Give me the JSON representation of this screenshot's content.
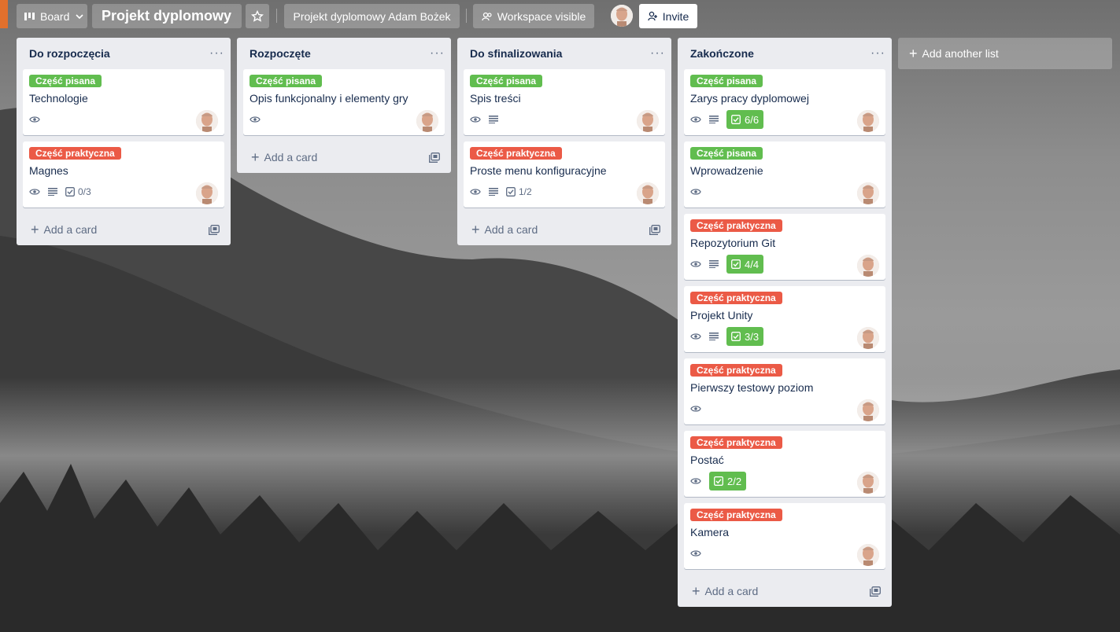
{
  "header": {
    "board_switch_label": "Board",
    "board_title": "Projekt dyplomowy",
    "workspace_name": "Projekt dyplomowy Adam Bożek",
    "visibility_label": "Workspace visible",
    "invite_label": "Invite"
  },
  "colors": {
    "label_green": "#61bd4f",
    "label_red": "#eb5a46",
    "list_bg": "#ebecf0"
  },
  "lists": [
    {
      "title": "Do rozpoczęcia",
      "add_card": "Add a card",
      "cards": [
        {
          "label": "Część pisana",
          "title": "Technologie",
          "checklist": ""
        },
        {
          "label": "Część praktyczna",
          "title": "Magnes",
          "checklist": "0/3"
        }
      ]
    },
    {
      "title": "Rozpoczęte",
      "add_card": "Add a card",
      "cards": [
        {
          "label": "Część pisana",
          "title": "Opis funkcjonalny i elementy gry",
          "checklist": ""
        }
      ]
    },
    {
      "title": "Do sfinalizowania",
      "add_card": "Add a card",
      "cards": [
        {
          "label": "Część pisana",
          "title": "Spis treści",
          "checklist": ""
        },
        {
          "label": "Część praktyczna",
          "title": "Proste menu konfiguracyjne",
          "checklist": "1/2"
        }
      ]
    },
    {
      "title": "Zakończone",
      "add_card": "Add a card",
      "cards": [
        {
          "label": "Część pisana",
          "title": "Zarys pracy dyplomowej",
          "checklist": "6/6"
        },
        {
          "label": "Część pisana",
          "title": "Wprowadzenie",
          "checklist": ""
        },
        {
          "label": "Część praktyczna",
          "title": "Repozytorium Git",
          "checklist": "4/4"
        },
        {
          "label": "Część praktyczna",
          "title": "Projekt Unity",
          "checklist": "3/3"
        },
        {
          "label": "Część praktyczna",
          "title": "Pierwszy testowy poziom",
          "checklist": ""
        },
        {
          "label": "Część praktyczna",
          "title": "Postać",
          "checklist": "2/2"
        },
        {
          "label": "Część praktyczna",
          "title": "Kamera",
          "checklist": ""
        }
      ]
    }
  ],
  "add_list_label": "Add another list"
}
